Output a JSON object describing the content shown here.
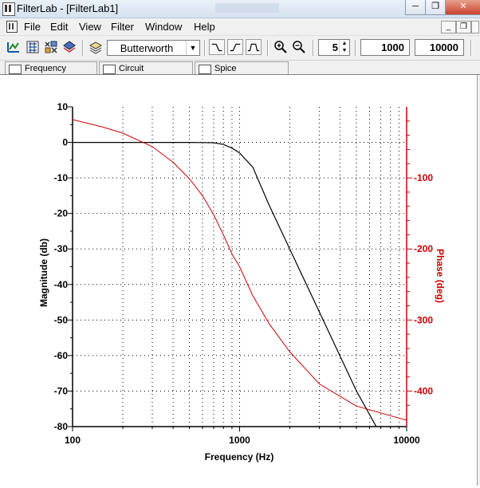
{
  "window": {
    "title": "FilterLab - [FilterLab1]",
    "minimize": "─",
    "restore": "❐",
    "close": "✕"
  },
  "menu": {
    "items": [
      "File",
      "Edit",
      "View",
      "Filter",
      "Window",
      "Help"
    ],
    "mdi_buttons": [
      "_",
      "❐",
      "×"
    ]
  },
  "toolbar": {
    "filter_type": "Butterworth",
    "order": "5",
    "freq_start": "1000",
    "freq_stop": "10000",
    "icons": [
      "design-filter-icon",
      "circuit-icon",
      "grid-icon",
      "stack-icon",
      "layers-icon"
    ],
    "response_buttons": [
      "⎍‾",
      "⎓",
      "⎍⎎"
    ]
  },
  "tabs": [
    {
      "label": "Frequency",
      "icon": "frequency-tab-icon"
    },
    {
      "label": "Circuit",
      "icon": "circuit-tab-icon"
    },
    {
      "label": "Spice",
      "icon": "spice-tab-icon"
    }
  ],
  "colors": {
    "magnitude": "#000000",
    "phase": "#cc0000",
    "grid": "#000000"
  },
  "chart_data": {
    "type": "line",
    "x_scale": "log",
    "xlabel": "Frequency (Hz)",
    "ylabel": "Magnitude (db)",
    "y2label": "Phase (deg)",
    "xlim": [
      100,
      10000
    ],
    "ylim": [
      -80,
      10
    ],
    "y2lim": [
      -450,
      0
    ],
    "x_ticks": [
      "100",
      "1000",
      "10000"
    ],
    "y_ticks": [
      "10",
      "0",
      "-10",
      "-20",
      "-30",
      "-40",
      "-50",
      "-60",
      "-70",
      "-80"
    ],
    "y2_ticks": [
      "-100",
      "-200",
      "-300",
      "-400"
    ],
    "grid": true,
    "series": [
      {
        "axis": "left",
        "x": [
          100,
          200,
          300,
          500,
          700,
          800,
          900,
          1000,
          1200,
          1500,
          2000,
          3000,
          5000,
          7000
        ],
        "values": [
          0,
          0,
          0,
          0,
          -0.1,
          -0.6,
          -1.6,
          -3.0,
          -7.0,
          -17.6,
          -30.1,
          -47.7,
          -69.9,
          -82.3
        ]
      },
      {
        "axis": "right",
        "x": [
          100,
          150,
          200,
          300,
          400,
          500,
          600,
          700,
          800,
          900,
          1000,
          1200,
          1500,
          2000,
          3000,
          5000,
          10000
        ],
        "values": [
          -18,
          -28,
          -37,
          -56,
          -78,
          -101,
          -125,
          -152,
          -180,
          -207,
          -225,
          -266,
          -305,
          -345,
          -390,
          -421,
          -441
        ]
      }
    ]
  }
}
